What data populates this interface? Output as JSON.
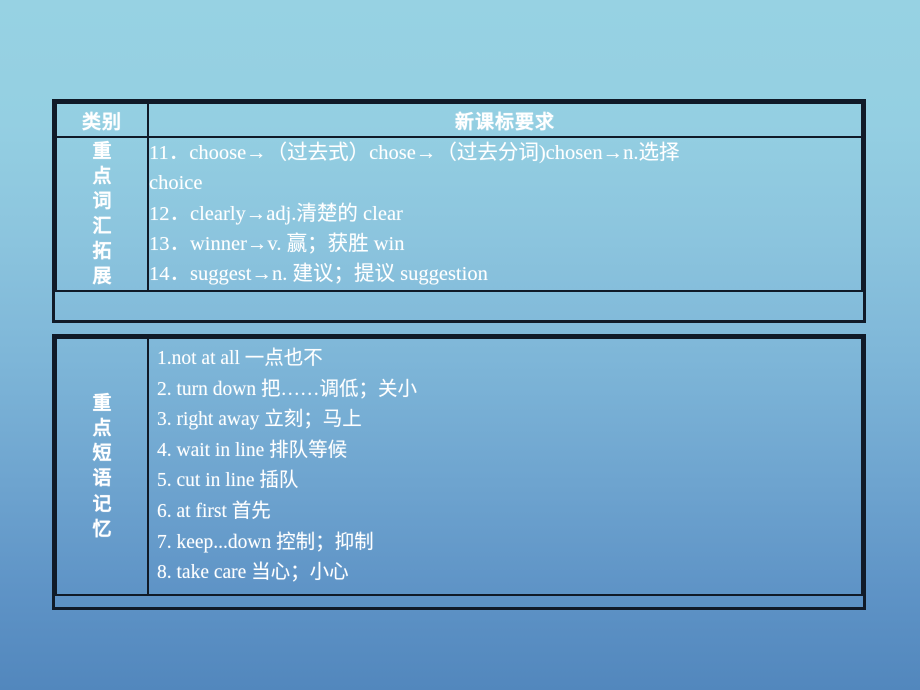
{
  "slide": {
    "background_top_color": "#97d2e3",
    "background_bottom_color": "#5287bd",
    "text_color": "#ffffff",
    "border_color": "#101a28"
  },
  "table": {
    "header": {
      "category_label": "类别",
      "requirement_label": "新课标要求"
    },
    "sections": [
      {
        "id": "vocab-expansion",
        "label_chars": [
          "重",
          "点",
          "词",
          "汇",
          "拓",
          "展"
        ],
        "lines": [
          "11．choose→（过去式）chose→（过去分词)chosen→n.选择",
          "choice",
          "12．clearly→adj.清楚的 clear",
          "13．winner→v. 赢；获胜 win",
          "14．suggest→n. 建议；提议 suggestion"
        ]
      },
      {
        "id": "phrase-memory",
        "label_chars": [
          "重",
          "点",
          "短",
          "语",
          "记",
          "忆"
        ],
        "lines": [
          "1.not at all 一点也不",
          "2. turn down 把……调低；关小",
          "3. right away 立刻；马上",
          "4. wait in line 排队等候",
          "5. cut in line 插队",
          "6. at first 首先",
          "7. keep...down 控制；抑制",
          "8. take care 当心；小心"
        ]
      }
    ]
  }
}
